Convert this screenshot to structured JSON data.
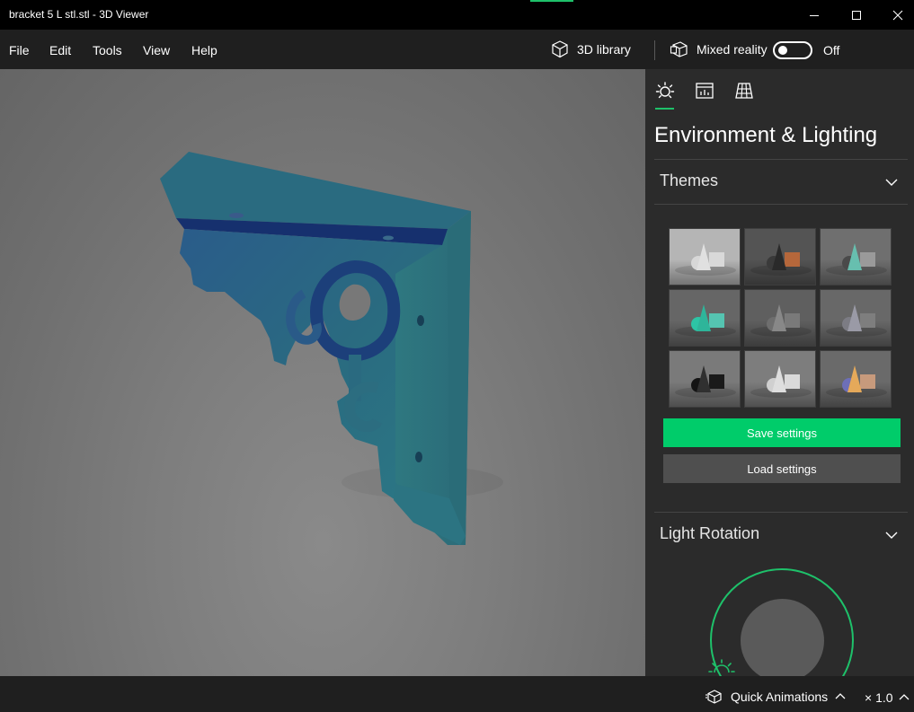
{
  "window": {
    "title": "bracket 5 L stl.stl - 3D Viewer"
  },
  "menu": {
    "items": [
      "File",
      "Edit",
      "Tools",
      "View",
      "Help"
    ]
  },
  "toolbar": {
    "library_label": "3D library",
    "mixed_reality_label": "Mixed reality",
    "toggle_state": "Off"
  },
  "panel": {
    "title": "Environment & Lighting",
    "tabs": [
      "sun-icon",
      "stats-icon",
      "grid-icon"
    ],
    "themes_title": "Themes",
    "themes": [
      {
        "name": "white",
        "bg": "#b5b5b5",
        "cone": "#e0e0e0",
        "sphere": "#d7d7d7",
        "cube": "#d9d9d9"
      },
      {
        "name": "copper",
        "bg": "#545454",
        "cone": "#2a2a2a",
        "sphere": "#3a3a3a",
        "cube": "#b5673b"
      },
      {
        "name": "teal-dark",
        "bg": "#6f6f6f",
        "cone": "#67bfaf",
        "sphere": "#4a4a4a",
        "cube": "#9a9a9a"
      },
      {
        "name": "teal",
        "bg": "#666666",
        "cone": "#2eb59a",
        "sphere": "#2dc4a5",
        "cube": "#55c4b1"
      },
      {
        "name": "grey",
        "bg": "#5f5f5f",
        "cone": "#888888",
        "sphere": "#6e6e6e",
        "cube": "#7a7a7a"
      },
      {
        "name": "glass",
        "bg": "#686868",
        "cone": "#9a9aa6",
        "sphere": "#7c7c84",
        "cube": "#7e7e7e"
      },
      {
        "name": "black",
        "bg": "#7a7a7a",
        "cone": "#303030",
        "sphere": "#141414",
        "cube": "#1a1a1a"
      },
      {
        "name": "white-2",
        "bg": "#7d7d7d",
        "cone": "#dedede",
        "sphere": "#d0d0d0",
        "cube": "#dadada"
      },
      {
        "name": "pastel",
        "bg": "#6a6a6a",
        "cone": "#e5a95a",
        "sphere": "#6d6fb8",
        "cube": "#c79a7c"
      }
    ],
    "save_label": "Save settings",
    "load_label": "Load settings",
    "light_title": "Light Rotation"
  },
  "status": {
    "quick_animations_label": "Quick Animations",
    "speed": "× 1.0"
  },
  "colors": {
    "accent": "#1ec16a",
    "save_button": "#00cc6a",
    "model": "#2a6878"
  }
}
